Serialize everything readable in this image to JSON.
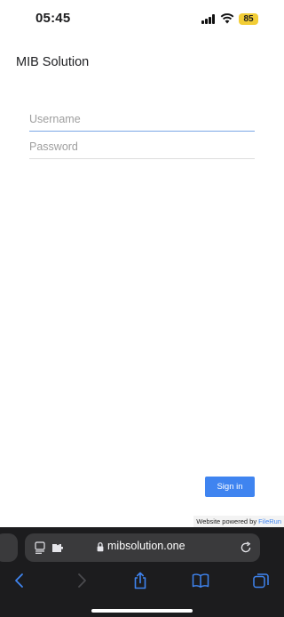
{
  "status_bar": {
    "time": "05:45",
    "battery": "85"
  },
  "app": {
    "title": "MIB Solution"
  },
  "form": {
    "username_placeholder": "Username",
    "password_placeholder": "Password",
    "sign_in_label": "Sign in"
  },
  "footer": {
    "powered_prefix": "Website powered by ",
    "powered_brand": "FileRun"
  },
  "browser": {
    "url": "mibsolution.one",
    "icons": [
      "reader-icon",
      "extension-icon",
      "lock-icon",
      "reload-icon",
      "back-icon",
      "forward-icon",
      "share-icon",
      "bookmarks-icon",
      "tabs-icon"
    ]
  },
  "colors": {
    "accent": "#3f84f0",
    "battery": "#f2cd36",
    "browser_bg": "#1c1c1e"
  }
}
